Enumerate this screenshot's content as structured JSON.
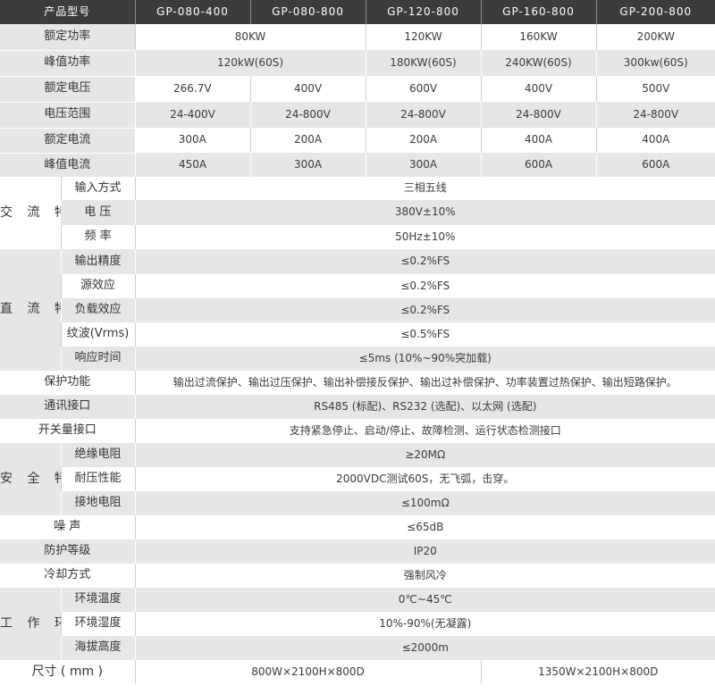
{
  "header": {
    "label": "产品型号",
    "models": [
      "GP-080-400",
      "GP-080-800",
      "GP-120-800",
      "GP-160-800",
      "GP-200-800"
    ]
  },
  "top_rows": {
    "rated_power": {
      "label": "额定功率",
      "shared_080": "80KW",
      "m120": "120KW",
      "m160": "160KW",
      "m200": "200KW"
    },
    "peak_power": {
      "label": "峰值功率",
      "shared_080": "120kW(60S)",
      "m120": "180KW(60S)",
      "m160": "240KW(60S)",
      "m200": "300kw(60S)"
    },
    "rated_voltage": {
      "label": "额定电压",
      "values": [
        "266.7V",
        "400V",
        "600V",
        "400V",
        "500V"
      ]
    },
    "voltage_range": {
      "label": "电压范围",
      "values": [
        "24-400V",
        "24-800V",
        "24-800V",
        "24-800V",
        "24-800V"
      ]
    },
    "rated_current": {
      "label": "额定电流",
      "values": [
        "300A",
        "200A",
        "200A",
        "400A",
        "400A"
      ]
    },
    "peak_current": {
      "label": "峰值电流",
      "values": [
        "450A",
        "300A",
        "300A",
        "600A",
        "600A"
      ]
    }
  },
  "ac": {
    "category": "交 流 特 性",
    "input_mode": {
      "label": "输入方式",
      "value": "三相五线"
    },
    "voltage": {
      "label": "电 压",
      "value": "380V±10%"
    },
    "frequency": {
      "label": "频 率",
      "value": "50Hz±10%"
    }
  },
  "dc": {
    "category": "直 流 特 性",
    "output_accuracy": {
      "label": "输出精度",
      "value": "≤0.2%FS"
    },
    "source_effect": {
      "label": "源效应",
      "value": "≤0.2%FS"
    },
    "load_effect": {
      "label": "负载效应",
      "value": "≤0.2%FS"
    },
    "ripple": {
      "label": "纹波(Vrms)",
      "value": "≤0.5%FS"
    },
    "response_time": {
      "label": "响应时间",
      "value": "≤5ms (10%~90%突加载)"
    }
  },
  "protection": {
    "label": "保护功能",
    "value": "输出过流保护、输出过压保护、输出补偿接反保护、输出过补偿保护、功率装置过热保护、输出短路保护。"
  },
  "comm": {
    "label": "通讯接口",
    "value": "RS485 (标配)、RS232 (选配)、以太网 (选配)"
  },
  "switch_io": {
    "label": "开关量接口",
    "value": "支持紧急停止、启动/停止、故障检测、运行状态检测接口"
  },
  "safety": {
    "category": "安 全 特 性",
    "insulation": {
      "label": "绝缘电阻",
      "value": "≥20MΩ"
    },
    "withstand": {
      "label": "耐压性能",
      "value": "2000VDC测试60S，无飞弧，击穿。"
    },
    "ground": {
      "label": "接地电阻",
      "value": "≤100mΩ"
    }
  },
  "noise": {
    "label": "噪 声",
    "value": "≤65dB"
  },
  "ip": {
    "label": "防护等级",
    "value": "IP20"
  },
  "cooling": {
    "label": "冷却方式",
    "value": "强制风冷"
  },
  "env": {
    "category": "工 作 环 境",
    "temp": {
      "label": "环境温度",
      "value": "0℃~45℃"
    },
    "humidity": {
      "label": "环境湿度",
      "value": "10%-90%(无凝露)"
    },
    "altitude": {
      "label": "海拔高度",
      "value": "≤2000m"
    }
  },
  "size": {
    "label": "尺寸 ( mm )",
    "small": "800W×2100H×800D",
    "large": "1350W×2100H×800D"
  }
}
